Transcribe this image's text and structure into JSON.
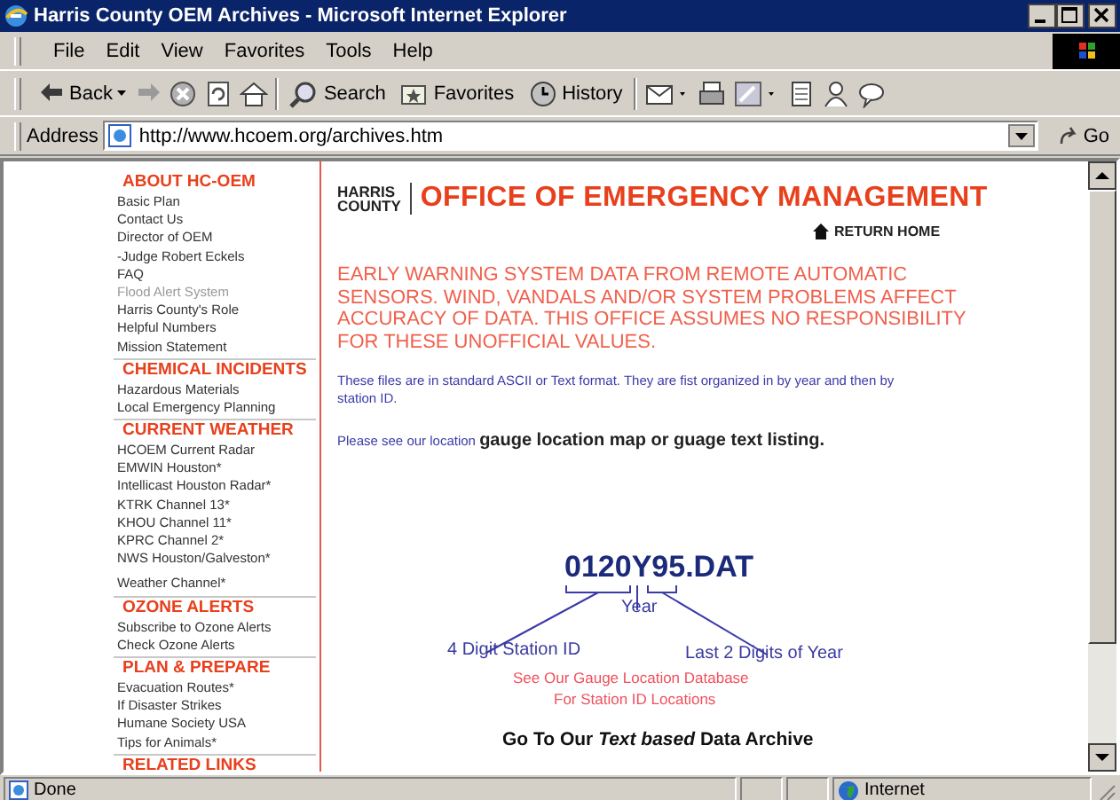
{
  "window": {
    "title": "Harris County OEM Archives - Microsoft Internet Explorer"
  },
  "menu": [
    "File",
    "Edit",
    "View",
    "Favorites",
    "Tools",
    "Help"
  ],
  "toolbar": [
    {
      "kind": "back",
      "label": "Back"
    },
    {
      "kind": "forward"
    },
    {
      "kind": "stop"
    },
    {
      "kind": "refresh"
    },
    {
      "kind": "home"
    },
    {
      "kind": "search",
      "label": "Search"
    },
    {
      "kind": "favorites",
      "label": "Favorites"
    },
    {
      "kind": "history",
      "label": "History"
    },
    {
      "kind": "mail"
    },
    {
      "kind": "print"
    },
    {
      "kind": "edit"
    },
    {
      "kind": "page"
    },
    {
      "kind": "people"
    },
    {
      "kind": "discuss"
    }
  ],
  "address": {
    "label": "Address",
    "value": "http://www.hcoem.org/archives.htm",
    "go": "Go"
  },
  "sidebar": [
    {
      "heading": "ABOUT HC-OEM",
      "items": [
        {
          "label": "Basic Plan",
          "current": false
        },
        {
          "label": "Contact Us",
          "current": false
        },
        {
          "label": "Director of OEM",
          "current": false
        },
        {
          "label": "-Judge Robert Eckels",
          "current": false
        },
        {
          "label": "FAQ",
          "current": false
        },
        {
          "label": "Flood Alert System",
          "current": true
        },
        {
          "label": "Harris County's Role",
          "current": false
        },
        {
          "label": "Helpful Numbers",
          "current": false
        },
        {
          "label": "Mission Statement",
          "current": false
        }
      ]
    },
    {
      "heading": "CHEMICAL INCIDENTS",
      "items": [
        {
          "label": "Hazardous Materials",
          "current": false
        },
        {
          "label": "Local Emergency Planning",
          "current": false
        }
      ]
    },
    {
      "heading": "CURRENT WEATHER",
      "items": [
        {
          "label": "HCOEM Current Radar",
          "current": false
        },
        {
          "label": "EMWIN Houston*",
          "current": false
        },
        {
          "label": "Intellicast Houston Radar*",
          "current": false
        },
        {
          "label": "KTRK Channel 13*",
          "current": false
        },
        {
          "label": "KHOU Channel 11*",
          "current": false
        },
        {
          "label": "KPRC Channel 2*",
          "current": false
        },
        {
          "label": "NWS Houston/Galveston*",
          "current": false
        },
        {
          "label": "Weather Channel*",
          "current": false
        }
      ]
    },
    {
      "heading": "OZONE ALERTS",
      "items": [
        {
          "label": "Subscribe to Ozone Alerts",
          "current": false
        },
        {
          "label": "Check Ozone Alerts",
          "current": false
        }
      ]
    },
    {
      "heading": "PLAN & PREPARE",
      "items": [
        {
          "label": "Evacuation Routes*",
          "current": false
        },
        {
          "label": "If Disaster Strikes",
          "current": false
        },
        {
          "label": "Humane Society USA",
          "current": false
        },
        {
          "label": "Tips for Animals*",
          "current": false
        }
      ]
    },
    {
      "heading": "RELATED LINKS"
    }
  ],
  "header": {
    "logo_top": "HARRIS",
    "logo_bottom": "COUNTY",
    "title": "OFFICE OF EMERGENCY MANAGEMENT",
    "return_home": "RETURN HOME"
  },
  "warning": "EARLY WARNING SYSTEM DATA FROM REMOTE AUTOMATIC SENSORS. WIND, VANDALS AND/OR SYSTEM PROBLEMS AFFECT ACCURACY OF DATA. THIS OFFICE ASSUMES NO RESPONSIBILITY FOR THESE UNOFFICIAL VALUES.",
  "info": "These files are in standard ASCII or Text format. They are fist organized in by year and then by station ID.",
  "location": {
    "prefix": "Please see our location",
    "link": "gauge location map or guage text listing."
  },
  "diagram": {
    "filename": "0120Y95.DAT",
    "year": "Year",
    "station": "4 Digit Station ID",
    "digits": "Last 2 Digits of Year",
    "note": [
      "See Our Gauge Location Database",
      "For Station ID Locations"
    ]
  },
  "archive": "Go To Our *Text based* Data Archive",
  "status": {
    "text": "Done",
    "zone": "Internet"
  }
}
